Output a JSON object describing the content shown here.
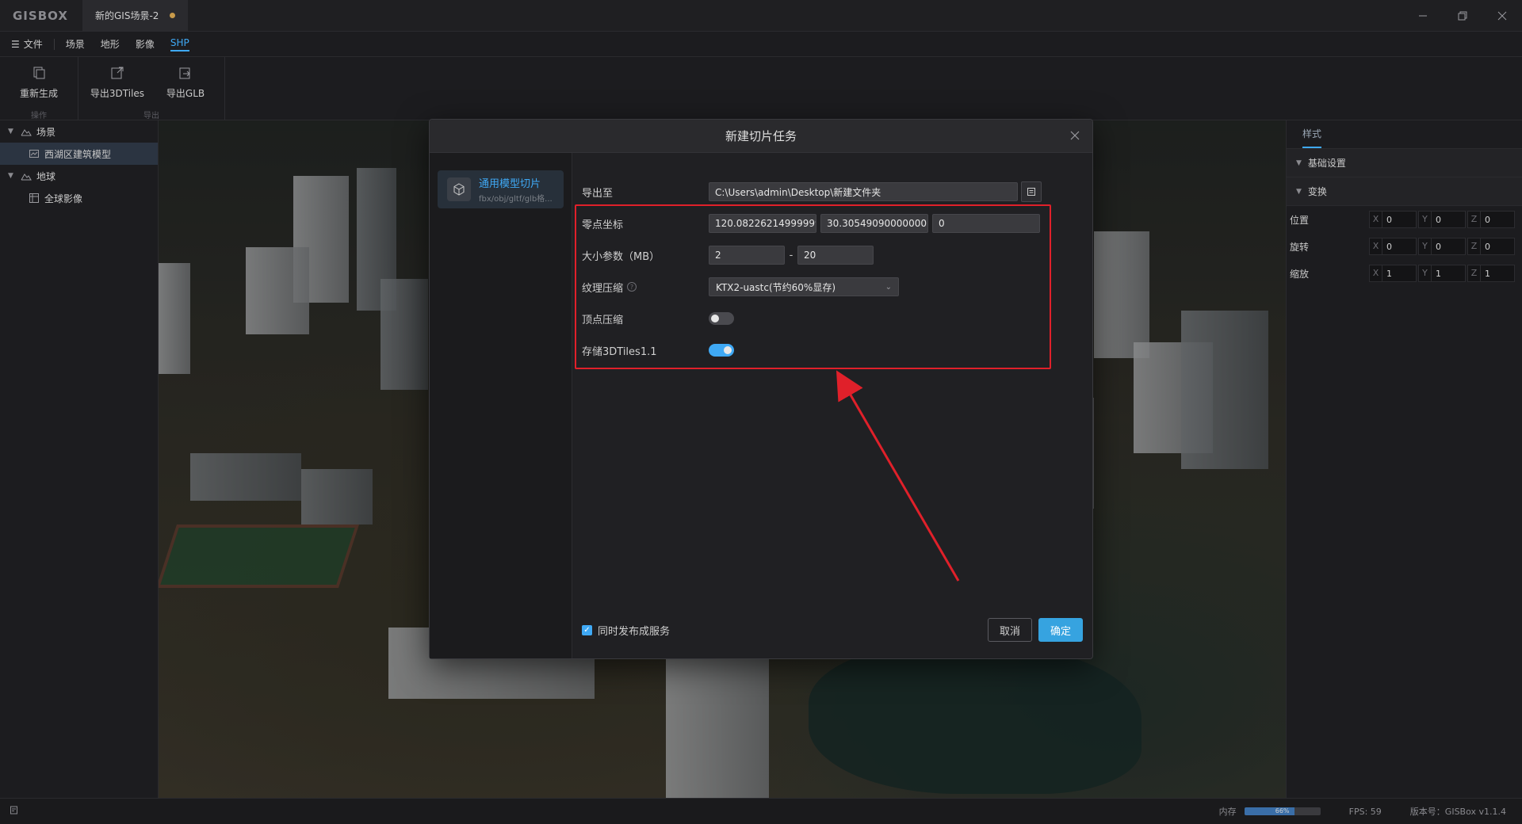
{
  "app": {
    "logo": "GISBOX",
    "doc_tab": "新的GIS场景-2"
  },
  "menu": {
    "file": "文件",
    "items": [
      "场景",
      "地形",
      "影像",
      "SHP"
    ],
    "active": "SHP"
  },
  "ribbon": {
    "groups": [
      {
        "label": "操作",
        "buttons": [
          {
            "label": "重新生成",
            "icon": "regenerate-icon"
          }
        ]
      },
      {
        "label": "导出",
        "buttons": [
          {
            "label": "导出3DTiles",
            "icon": "export-icon"
          },
          {
            "label": "导出GLB",
            "icon": "export-icon"
          }
        ]
      }
    ]
  },
  "tree": {
    "scene": "场景",
    "scene_child": "西湖区建筑模型",
    "globe": "地球",
    "globe_child": "全球影像"
  },
  "right_panel": {
    "tab": "样式",
    "section_basic": "基础设置",
    "section_transform": "变换",
    "rows": [
      {
        "label": "位置",
        "x": "0",
        "y": "0",
        "z": "0"
      },
      {
        "label": "旋转",
        "x": "0",
        "y": "0",
        "z": "0"
      },
      {
        "label": "缩放",
        "x": "1",
        "y": "1",
        "z": "1"
      }
    ],
    "axis_x": "X",
    "axis_y": "Y",
    "axis_z": "Z"
  },
  "dialog": {
    "title": "新建切片任务",
    "task": {
      "title": "通用模型切片",
      "subtitle": "fbx/obj/gltf/glb格..."
    },
    "fields": {
      "export_label": "导出至",
      "export_path": "C:\\Users\\admin\\Desktop\\新建文件夹",
      "origin_label": "零点坐标",
      "origin_x": "120.08226214999999",
      "origin_y": "30.30549090000000",
      "origin_z": "0",
      "size_label": "大小参数（MB）",
      "size_min": "2",
      "size_dash": "-",
      "size_max": "20",
      "texture_label": "纹理压缩",
      "texture_value": "KTX2-uastc(节约60%显存)",
      "vertex_label": "顶点压缩",
      "vertex_enabled": false,
      "store_label": "存储3DTiles1.1",
      "store_enabled": true
    },
    "footer": {
      "publish_label": "同时发布成服务",
      "publish_checked": true,
      "cancel": "取消",
      "ok": "确定"
    }
  },
  "status": {
    "memory_label": "内存",
    "memory_percent": 66,
    "memory_text": "66%",
    "fps": "FPS: 59",
    "version": "版本号：GISBox v1.1.4"
  },
  "colors": {
    "accent": "#3fa9f5",
    "annotation": "#e0202a"
  }
}
